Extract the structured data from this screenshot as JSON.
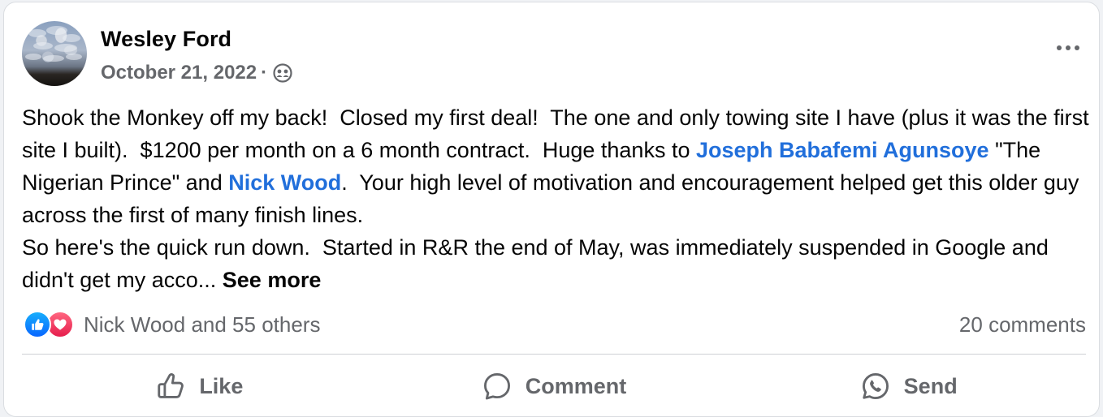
{
  "post": {
    "author": "Wesley Ford",
    "date": "October 21, 2022",
    "separator": "·",
    "audience_icon": "friends-icon",
    "body": {
      "text_1": "Shook the Monkey off my back!  Closed my first deal!  The one and only towing site I have (plus it was the first site I built).  $1200 per month on a 6 month contract.  Huge thanks to ",
      "mention_1": "Joseph Babafemi Agunsoye",
      "text_2": " \"The Nigerian Prince\" and ",
      "mention_2": "Nick Wood",
      "text_3": ".  Your high level of motivation and encouragement helped get this older guy across the first of many finish lines.\nSo here's the quick run down.  Started in R&R the end of May, was immediately suspended in Google and didn't get my acco... ",
      "see_more": "See more"
    },
    "reactions": {
      "icons": [
        "like-icon",
        "love-icon"
      ],
      "summary": "Nick Wood and 55 others"
    },
    "comments_count": "20 comments",
    "actions": {
      "like": "Like",
      "comment": "Comment",
      "send": "Send"
    }
  },
  "colors": {
    "mention": "#216fdb",
    "secondary_text": "#65676b",
    "like_blue": "#0866ff",
    "love_red": "#e61e4d"
  }
}
